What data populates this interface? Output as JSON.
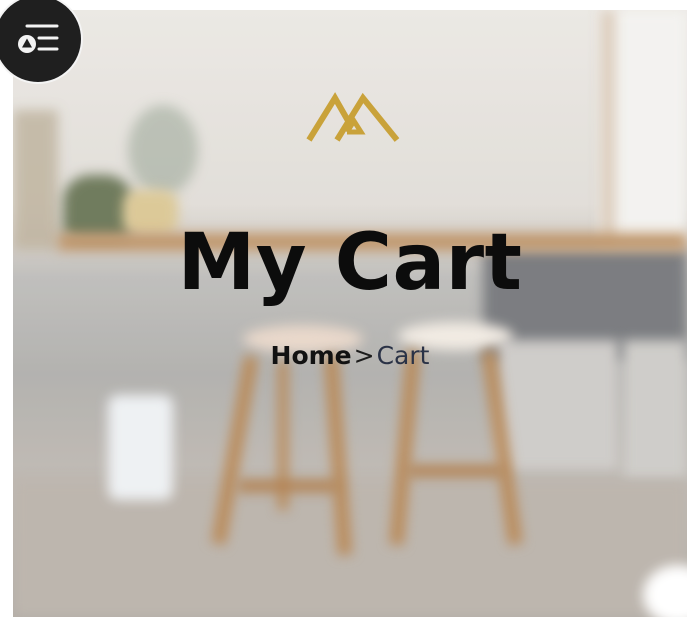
{
  "hero": {
    "title": "My Cart"
  },
  "breadcrumb": {
    "home": "Home",
    "separator": ">",
    "current": "Cart"
  },
  "menu_button": {
    "icon": "menu-lines-icon"
  },
  "logo": {
    "icon": "mountain-logo-icon"
  },
  "colors": {
    "logo_gold": "#c9a23a",
    "menu_bg": "#1f1f1f",
    "title": "#0c0c0c",
    "breadcrumb_current": "#2a3246"
  }
}
